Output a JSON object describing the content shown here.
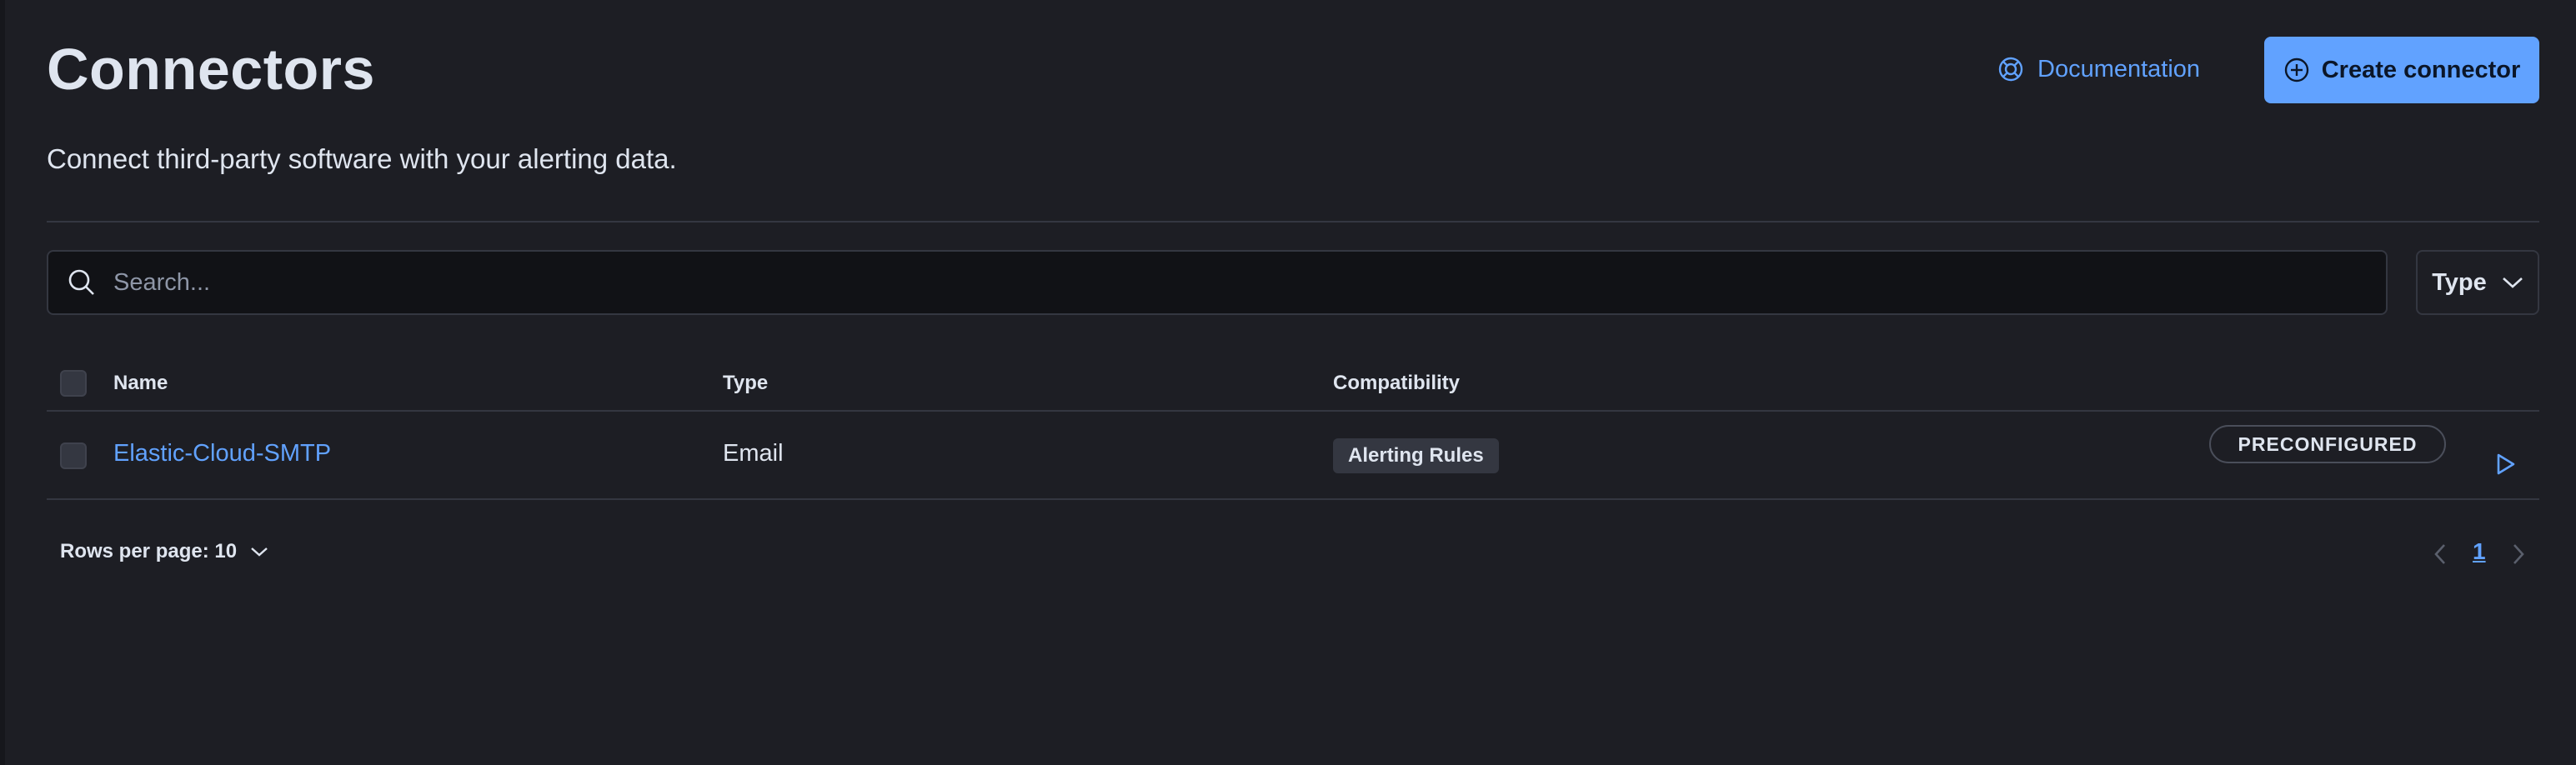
{
  "header": {
    "title": "Connectors",
    "subtitle": "Connect third-party software with your alerting data.",
    "documentation_label": "Documentation",
    "create_label": "Create connector"
  },
  "search": {
    "placeholder": "Search...",
    "value": ""
  },
  "filter": {
    "type_label": "Type"
  },
  "table": {
    "columns": [
      "Name",
      "Type",
      "Compatibility"
    ],
    "rows": [
      {
        "name": "Elastic-Cloud-SMTP",
        "type": "Email",
        "compatibility": "Alerting Rules",
        "badge": "PRECONFIGURED"
      }
    ]
  },
  "pagination": {
    "rows_per_page_label": "Rows per page: 10",
    "current_page": "1"
  },
  "icons": {
    "documentation": "lifebuoy-icon",
    "create": "plus-circle-icon",
    "search": "search-icon",
    "type_filter": "chevron-down-icon",
    "row_action": "play-icon"
  },
  "colors": {
    "background": "#1d1e24",
    "accent": "#61a2ff",
    "text": "#dfe5ef",
    "border": "#343741"
  }
}
